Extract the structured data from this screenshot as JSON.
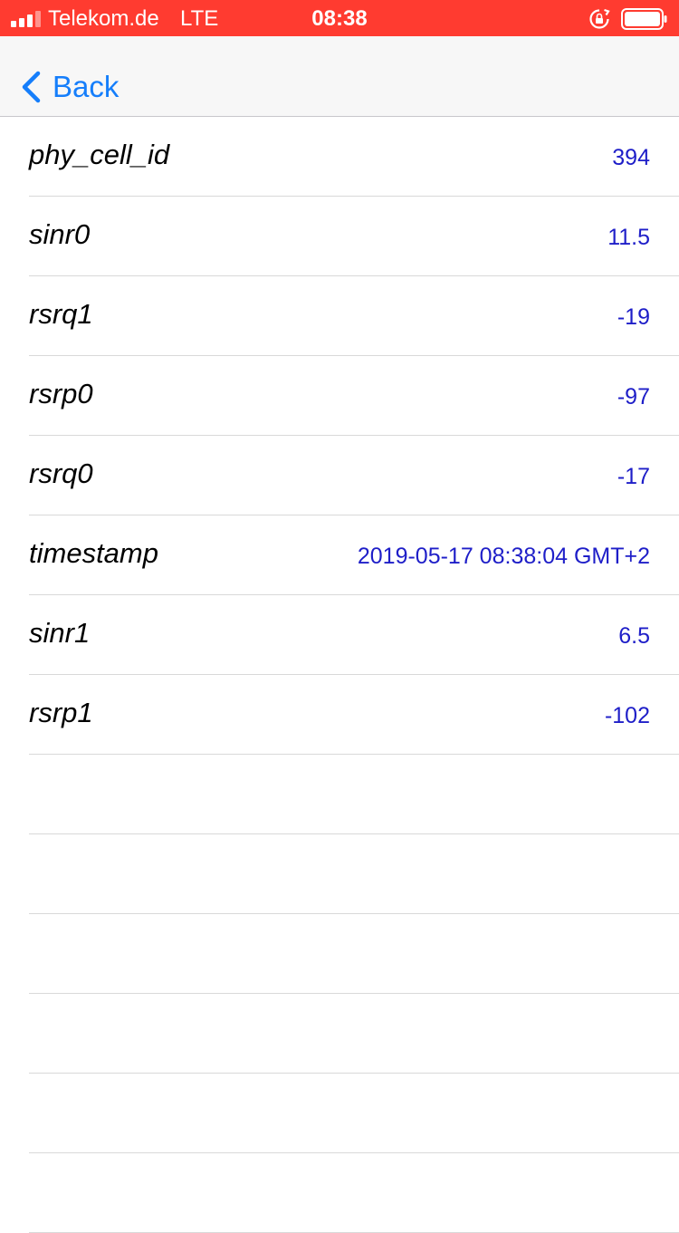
{
  "status_bar": {
    "carrier": "Telekom.de",
    "network": "LTE",
    "time": "08:38",
    "background_color": "#ff3b30",
    "signal_bars": 3,
    "signal_bars_total": 4
  },
  "nav": {
    "back_label": "Back",
    "accent_color": "#157efb"
  },
  "rows": [
    {
      "key": "phy_cell_id",
      "value": "394"
    },
    {
      "key": "sinr0",
      "value": "11.5"
    },
    {
      "key": "rsrq1",
      "value": "-19"
    },
    {
      "key": "rsrp0",
      "value": "-97"
    },
    {
      "key": "rsrq0",
      "value": "-17"
    },
    {
      "key": "timestamp",
      "value": "2019-05-17 08:38:04 GMT+2"
    },
    {
      "key": "sinr1",
      "value": "6.5"
    },
    {
      "key": "rsrp1",
      "value": "-102"
    },
    {
      "key": "",
      "value": ""
    },
    {
      "key": "",
      "value": ""
    },
    {
      "key": "",
      "value": ""
    },
    {
      "key": "",
      "value": ""
    },
    {
      "key": "",
      "value": ""
    },
    {
      "key": "",
      "value": ""
    }
  ],
  "value_color": "#1e1ec8"
}
